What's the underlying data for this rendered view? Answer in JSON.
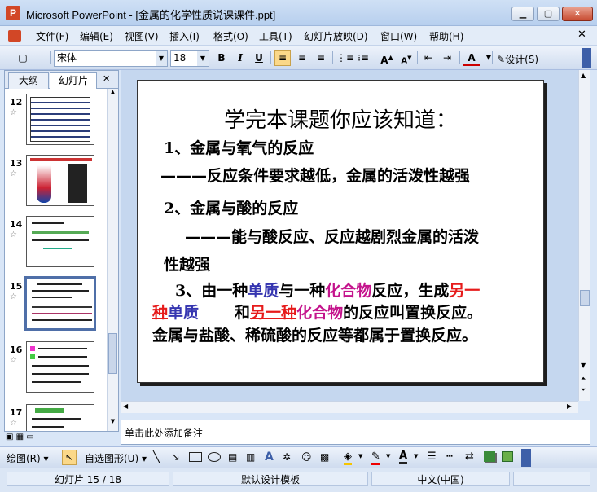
{
  "window": {
    "title": "Microsoft PowerPoint - [金属的化学性质说课课件.ppt]",
    "min": "▁",
    "max": "▢",
    "close": "✕"
  },
  "menu": [
    "文件(F)",
    "编辑(E)",
    "视图(V)",
    "插入(I)",
    "格式(O)",
    "工具(T)",
    "幻灯片放映(D)",
    "窗口(W)",
    "帮助(H)"
  ],
  "doc_close": "✕",
  "toolbar": {
    "font": "宋体",
    "size": "18",
    "bold": "B",
    "italic": "I",
    "underline": "U",
    "design": "设计(S)"
  },
  "panel": {
    "tabs": [
      "大纲",
      "幻灯片"
    ],
    "close": "✕",
    "thumbs": [
      "12",
      "13",
      "14",
      "15",
      "16",
      "17"
    ],
    "selected": "15",
    "star": "☆"
  },
  "slide": {
    "title": "学完本课题你应该知道：",
    "l1": "1、金属与氧气的反应",
    "l2": "———反应条件要求越低，金属的活泼性越强",
    "l3": "2、金属与酸的反应",
    "l4": "———能与酸反应、反应越剧烈金属的活泼",
    "l5": "性越强",
    "l6a": "3、由一种",
    "l6b": "单质",
    "l6c": "与一种",
    "l6d": "化合物",
    "l6e": "反应，生成",
    "l6f": "另一",
    "l7a": "种",
    "l7b": "单质",
    "l7c": "和",
    "l7d": "另一种",
    "l7e": "化合物",
    "l7f": "的反应叫置换反应。",
    "l8": "金属与盐酸、稀硫酸的反应等都属于置换反应。"
  },
  "notes": "单击此处添加备注",
  "draw": {
    "draw": "绘图(R)",
    "autoshape": "自选图形(U)"
  },
  "status": {
    "slide": "幻灯片 15 / 18",
    "template": "默认设计模板",
    "lang": "中文(中国)"
  },
  "colors": {
    "accent": "#fbd889",
    "selected_border": "#4f6fa8"
  }
}
